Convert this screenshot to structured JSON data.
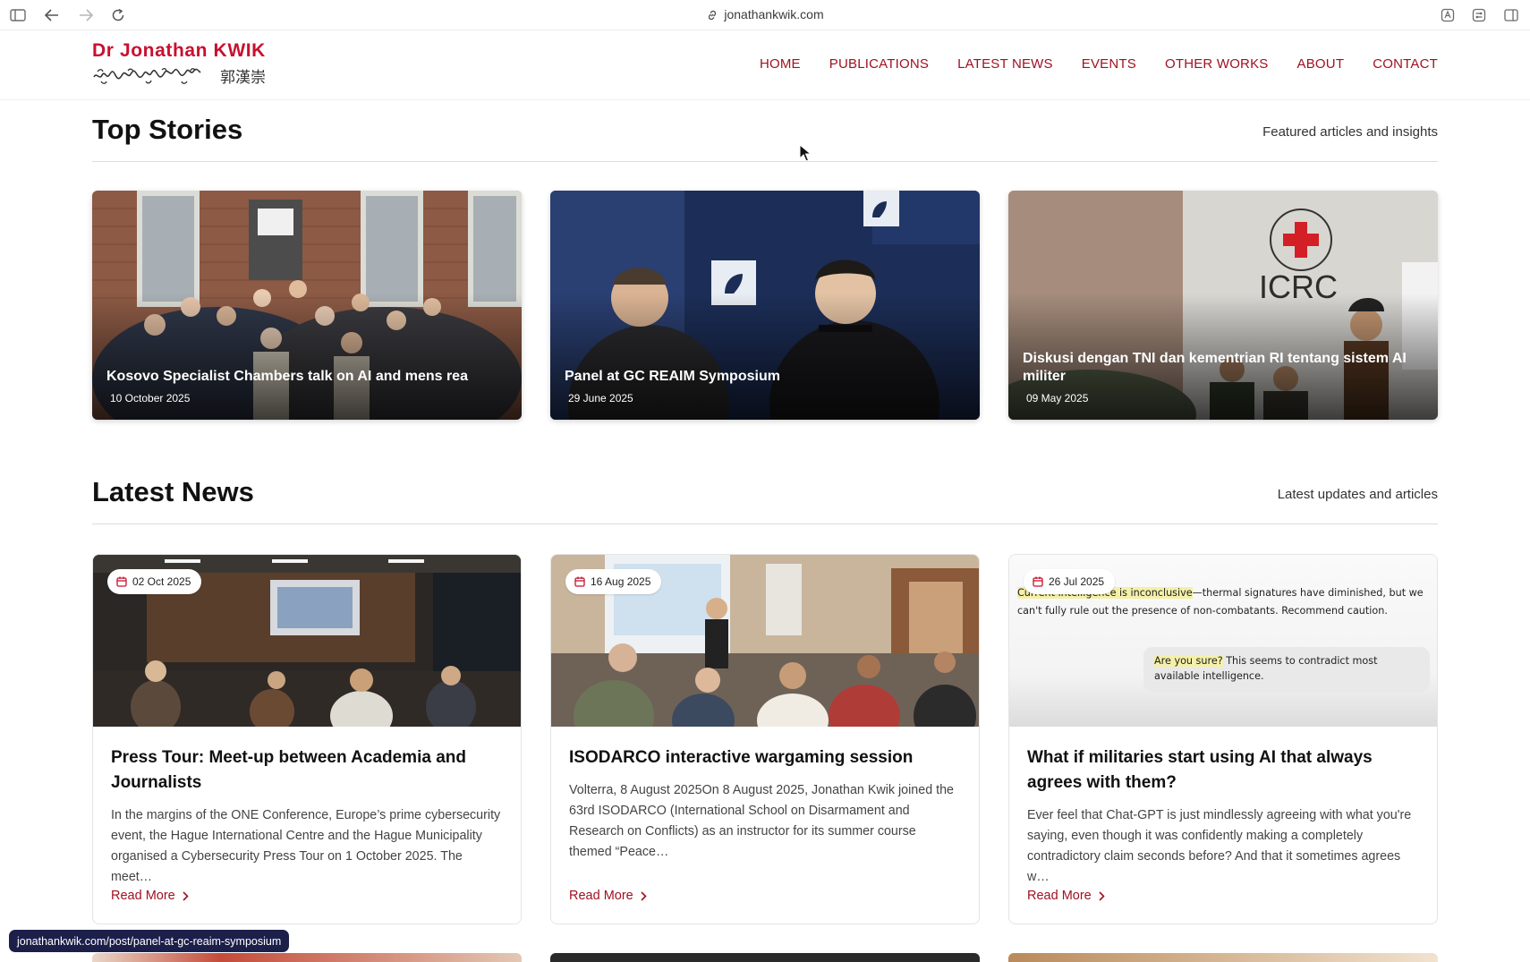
{
  "browser": {
    "url": "jonathankwik.com",
    "status_link": "jonathankwik.com/post/panel-at-gc-reaim-symposium"
  },
  "site": {
    "logo_title": "Dr Jonathan KWIK",
    "logo_cjk": "郭漢崇",
    "brand_color": "#c8102e",
    "nav": [
      "HOME",
      "PUBLICATIONS",
      "LATEST NEWS",
      "EVENTS",
      "OTHER WORKS",
      "ABOUT",
      "CONTACT"
    ]
  },
  "top_stories": {
    "heading": "Top Stories",
    "subheading": "Featured articles and insights",
    "items": [
      {
        "title": "Kosovo Specialist Chambers talk on AI and mens rea",
        "date": "10 October 2025"
      },
      {
        "title": "Panel at GC REAIM Symposium",
        "date": "29 June 2025"
      },
      {
        "title": "Diskusi dengan TNI dan kementrian RI tentang sistem AI militer",
        "date": "09 May 2025"
      }
    ]
  },
  "latest_news": {
    "heading": "Latest News",
    "subheading": "Latest updates and articles",
    "read_more": "Read More",
    "items": [
      {
        "date": "02 Oct 2025",
        "title": "Press Tour: Meet-up between Academia and Journalists",
        "excerpt": "In the margins of the ONE Conference, Europe’s prime cybersecurity event, the Hague International Centre and the Hague Municipality organised a Cybersecurity Press Tour on 1 October 2025. The meet…"
      },
      {
        "date": "16 Aug 2025",
        "title": "ISODARCO interactive wargaming session",
        "excerpt": "Volterra, 8 August 2025On 8 August 2025, Jonathan Kwik joined the 63rd ISODARCO (International School on Disarmament and Research on Conflicts) as an instructor for its summer course themed “Peace…"
      },
      {
        "date": "26 Jul 2025",
        "title": "What if militaries start using AI that always agrees with them?",
        "excerpt": "Ever feel that Chat-GPT is just mindlessly agreeing with what you're saying, even though it was confidently making a completely contradictory claim seconds before? And that it sometimes agrees w…"
      }
    ],
    "thumb3": {
      "line_hl": "Current intelligence is inconclusive",
      "line_rest": "—thermal signatures have diminished, but we can't fully rule out the presence of non-combatants. Recommend caution.",
      "bubble_hl": "Are you sure?",
      "bubble_rest": " This seems to contradict most available intelligence."
    }
  }
}
